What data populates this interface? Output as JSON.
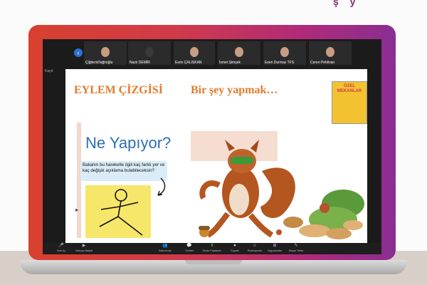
{
  "decor_heading": "ş  y",
  "participants": [
    {
      "name": "ÇiğdemDağlıoğlu"
    },
    {
      "name": "Nazlı DEMİR"
    },
    {
      "name": "Esrin ÇALISKAN"
    },
    {
      "name": "İsmet Şimşek"
    },
    {
      "name": "Esen Durmaz TFS"
    },
    {
      "name": "Ceren Pehlivan"
    }
  ],
  "screen_share_label": "Kayıt",
  "slide": {
    "title": "EYLEM ÇİZGİSİ",
    "subtitle": "Bir şey yapmak…",
    "book_title": "ÖZEL MEKANLAR",
    "card_heading": "Ne Yapıyor?",
    "card_question": "Bakalım bu hareketle ilgili kaç farklı yer ve kaç değişik açıklama bulabileceksin?"
  },
  "toolbar": [
    {
      "icon": "mic-icon",
      "glyph": "🎤",
      "label": "Sesi Aç"
    },
    {
      "icon": "video-icon",
      "glyph": "▶",
      "label": "Videoyu Başlat"
    },
    {
      "icon": "participants-icon",
      "glyph": "👥",
      "label": "Katılımcılar"
    },
    {
      "icon": "chat-icon",
      "glyph": "💬",
      "label": "Sohbet"
    },
    {
      "icon": "share-icon",
      "glyph": "⬆",
      "label": "Ekran Paylaşımı",
      "accent": "#3cbb3c"
    },
    {
      "icon": "record-icon",
      "glyph": "⏺",
      "label": "Kaydet"
    },
    {
      "icon": "reactions-icon",
      "glyph": "☺",
      "label": "Reaksiyonlar"
    },
    {
      "icon": "apps-icon",
      "glyph": "⊞",
      "label": "Uygulamalar"
    },
    {
      "icon": "whiteboard-icon",
      "glyph": "✎",
      "label": "Beyaz Tahta"
    }
  ],
  "colors": {
    "bezel_left": "#d8402f",
    "bezel_right": "#8a2e92",
    "slide_heading": "#e07b2e",
    "card_heading": "#2b6fb6",
    "share_accent": "#3cbb3c"
  }
}
